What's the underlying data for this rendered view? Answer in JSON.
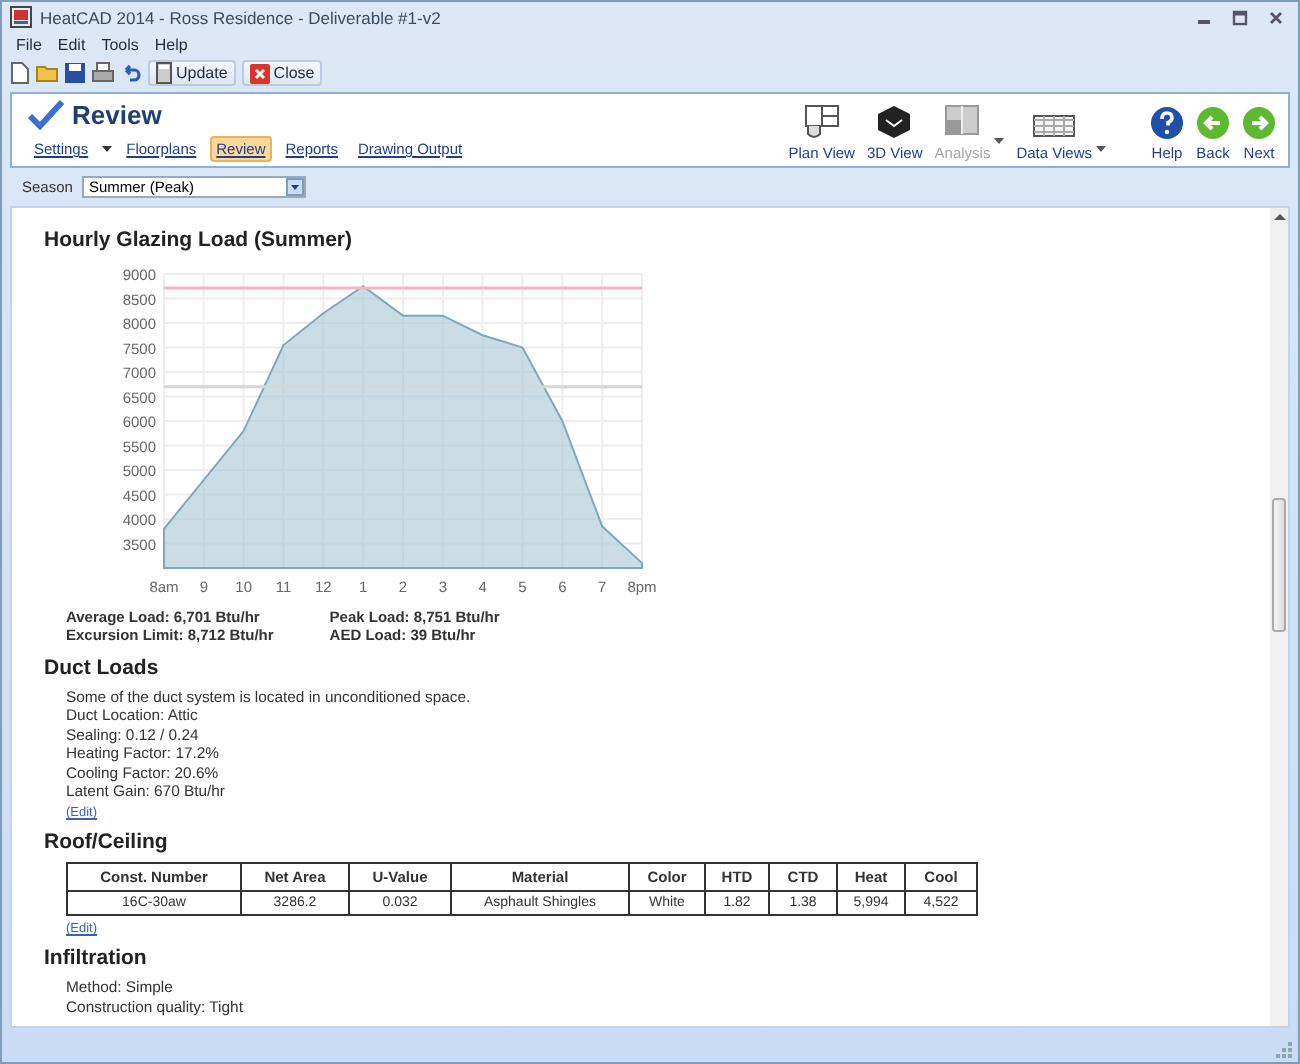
{
  "window": {
    "title": "HeatCAD 2014 - Ross Residence - Deliverable #1-v2"
  },
  "menu": [
    "File",
    "Edit",
    "Tools",
    "Help"
  ],
  "toolbar": {
    "buttons": [
      {
        "label": "Update"
      },
      {
        "label": "Close"
      }
    ]
  },
  "ribbon": {
    "title": "Review",
    "nav": [
      {
        "label": "Settings",
        "selected": false,
        "dropdown": true
      },
      {
        "label": "Floorplans",
        "selected": false,
        "dropdown": false
      },
      {
        "label": "Review",
        "selected": true,
        "dropdown": false
      },
      {
        "label": "Reports",
        "selected": false,
        "dropdown": false
      },
      {
        "label": "Drawing Output",
        "selected": false,
        "dropdown": false
      }
    ],
    "tools": [
      {
        "label": "Plan View",
        "disabled": false,
        "dropdown": false
      },
      {
        "label": "3D View",
        "disabled": false,
        "dropdown": false
      },
      {
        "label": "Analysis",
        "disabled": true,
        "dropdown": true
      },
      {
        "label": "Data Views",
        "disabled": false,
        "dropdown": true
      }
    ],
    "actions": [
      {
        "label": "Help"
      },
      {
        "label": "Back"
      },
      {
        "label": "Next"
      }
    ]
  },
  "season": {
    "label": "Season",
    "value": "Summer (Peak)"
  },
  "sections": [
    {
      "kind": "chart",
      "title": "Hourly Glazing Load (Summer)",
      "chart_data": {
        "type": "area",
        "categories": [
          "8am",
          "9",
          "10",
          "11",
          "12",
          "1",
          "2",
          "3",
          "4",
          "5",
          "6",
          "7",
          "8pm"
        ],
        "series": [
          {
            "color": "#a9c6d2",
            "values": [
              3800,
              4800,
              5800,
              7550,
              8200,
              8750,
              8150,
              8150,
              7750,
              7500,
              6000,
              3850,
              3100
            ]
          }
        ],
        "grid": true,
        "ylim": [
          3000,
          9000
        ],
        "yticks": [
          3500,
          4000,
          4500,
          5000,
          5500,
          6000,
          6500,
          7000,
          7500,
          8000,
          8500,
          9000
        ],
        "ref_lines": [
          {
            "axis": "y",
            "value": 8712,
            "color": "#f7b3c2"
          },
          {
            "axis": "y",
            "value": 6701,
            "color": "#d6d6d6"
          }
        ]
      },
      "stats": [
        [
          "Average Load: 6,701 Btu/hr",
          "Excursion Limit: 8,712 Btu/hr"
        ],
        [
          "Peak Load: 8,751 Btu/hr",
          "AED Load: 39 Btu/hr"
        ]
      ]
    },
    {
      "kind": "text",
      "title": "Duct Loads",
      "lines": [
        "Some of the duct system is located in unconditioned space.",
        "Duct Location: Attic",
        "Sealing: 0.12 / 0.24",
        "Heating Factor: 17.2%",
        "Cooling Factor: 20.6%",
        "Latent Gain: 670 Btu/hr"
      ],
      "link": "(Edit)"
    },
    {
      "kind": "table",
      "title": "Roof/Ceiling",
      "columns": [
        "Const. Number",
        "Net Area",
        "U-Value",
        "Material",
        "Color",
        "HTD",
        "CTD",
        "Heat",
        "Cool"
      ],
      "rows": [
        [
          "16C-30aw",
          "3286.2",
          "0.032",
          "Asphault Shingles",
          "White",
          "1.82",
          "1.38",
          "5,994",
          "4,522"
        ]
      ],
      "link": "(Edit)"
    },
    {
      "kind": "text",
      "title": "Infiltration",
      "lines": [
        "Method: Simple",
        "Construction quality: Tight"
      ]
    }
  ]
}
